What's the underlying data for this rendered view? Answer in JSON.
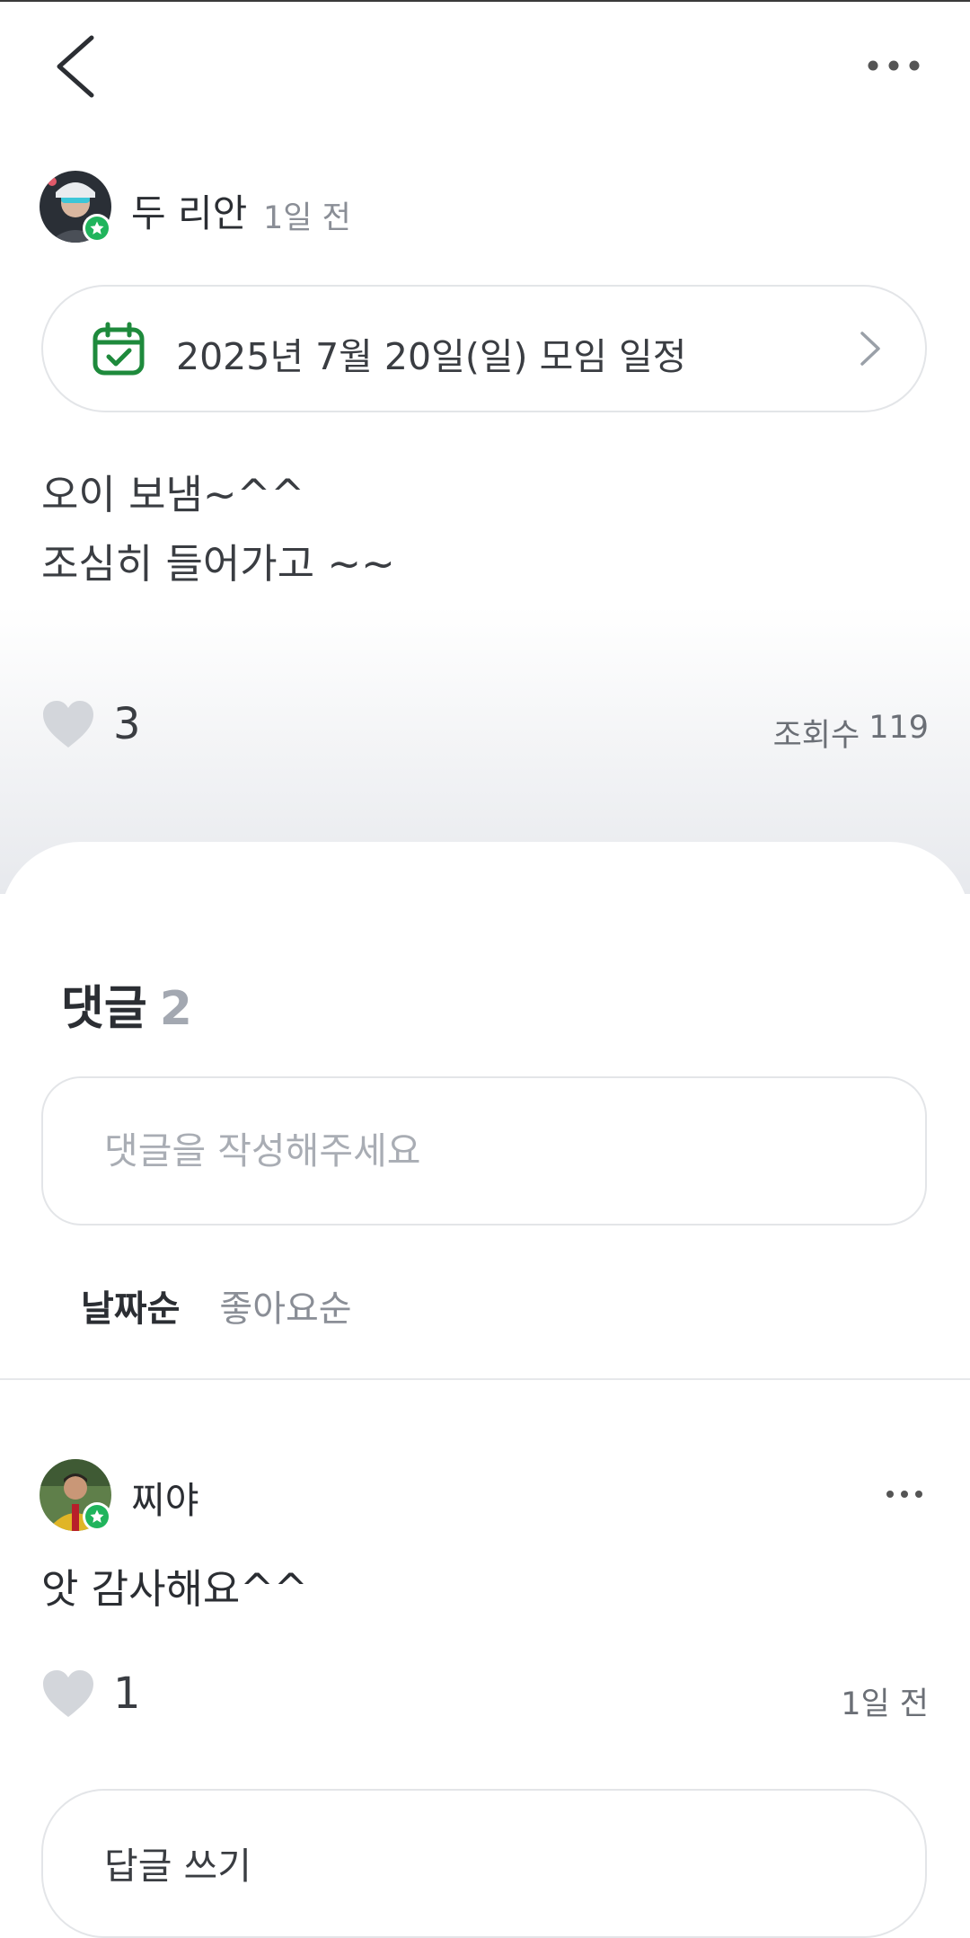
{
  "header": {
    "back_icon": "chevron-left-icon",
    "more_icon": "more-horizontal-icon"
  },
  "post": {
    "author": "두 리안",
    "time": "1일 전",
    "schedule": {
      "label": "2025년 7월 20일(일) 모임 일정",
      "icon": "calendar-check-icon",
      "accent": "#1e8a3c"
    },
    "body_lines": [
      "오이 보냄~^^",
      "조심히 들어가고 ~~"
    ],
    "likes": "3",
    "views_label": "조회수",
    "views_count": "119"
  },
  "comments": {
    "title": "댓글",
    "count": "2",
    "input_placeholder": "댓글을 작성해주세요",
    "sort_options": [
      "날짜순",
      "좋아요순"
    ],
    "selected_sort": "날짜순",
    "items": [
      {
        "author": "찌야",
        "text": "앗 감사해요^^",
        "likes": "1",
        "time": "1일 전",
        "reply_label": "답글 쓰기"
      }
    ]
  },
  "colors": {
    "badge_green": "#20b45c",
    "heart_gray": "#d3d6db",
    "muted_text": "#8a8e96"
  }
}
